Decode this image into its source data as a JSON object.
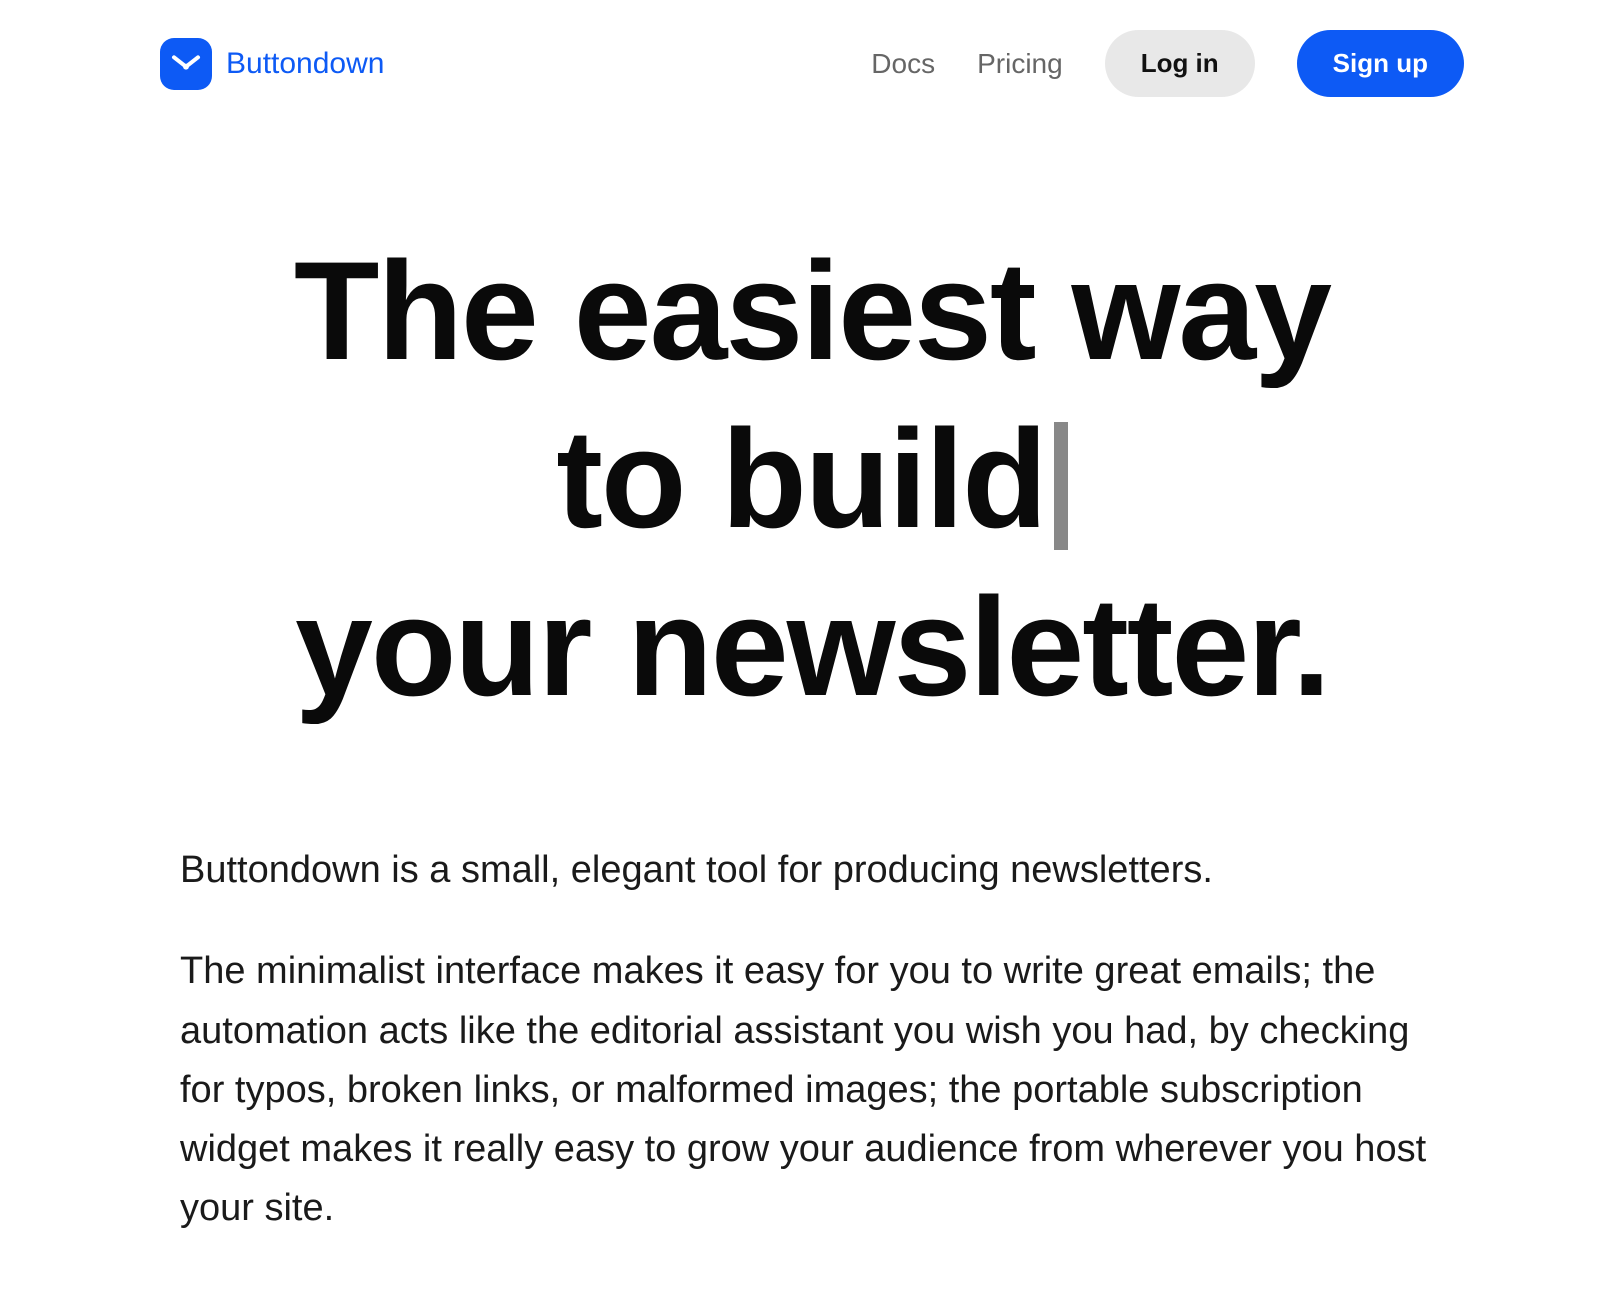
{
  "header": {
    "brand": "Buttondown",
    "nav": {
      "docs": "Docs",
      "pricing": "Pricing",
      "login": "Log in",
      "signup": "Sign up"
    }
  },
  "hero": {
    "line1": "The easiest way",
    "line2_pre": "to build",
    "line3": "your newsletter."
  },
  "body": {
    "p1": "Buttondown is a small, elegant tool for producing newsletters.",
    "p2": "The minimalist interface makes it easy for you to write great emails; the automation acts like the editorial assistant you wish you had, by checking for typos, broken links, or malformed images; the portable subscription widget makes it really easy to grow your audience from wherever you host your site."
  }
}
